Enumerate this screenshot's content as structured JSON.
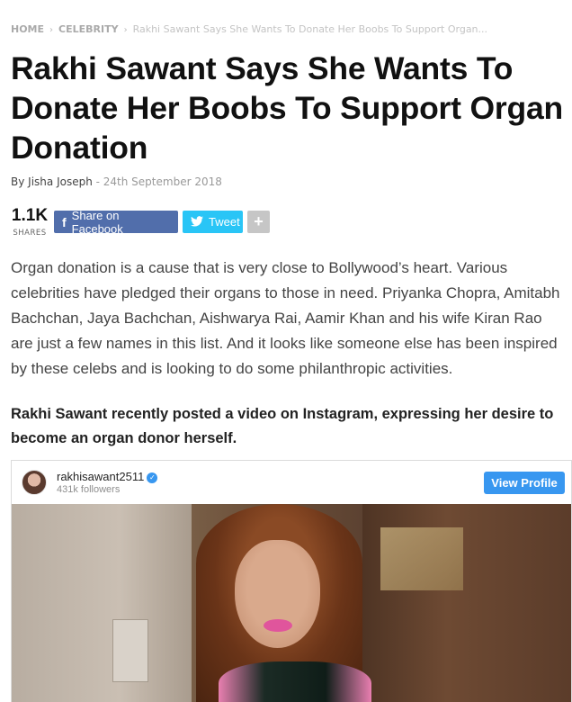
{
  "breadcrumb": {
    "home": "HOME",
    "category": "CELEBRITY",
    "current": "Rakhi Sawant Says She Wants To Donate Her Boobs To Support Organ...",
    "separator": "›"
  },
  "article": {
    "title": "Rakhi Sawant Says She Wants To Donate Her Boobs To Support Organ Donation",
    "by_prefix": "By",
    "author": "Jisha Joseph",
    "date": "- 24th September 2018",
    "body": "Organ donation is a cause that is very close to Bollywood’s heart. Various celebrities have pledged their organs to those in need. Priyanka Chopra, Amitabh Bachchan, Jaya Bachchan, Aishwarya Rai, Aamir Khan and his wife Kiran Rao are just a few names in this list. And it looks like someone else has been inspired by these celebs and is looking to do some philanthropic activities.",
    "lead": "Rakhi Sawant recently posted a video on Instagram, expressing her desire to become an organ donor herself."
  },
  "share": {
    "count": "1.1K",
    "count_label": "SHARES",
    "facebook_label": "Share on Facebook",
    "twitter_label": "Tweet",
    "more_label": "+",
    "facebook_color": "#516eab",
    "twitter_color": "#29c5f6",
    "icons": {
      "facebook": "facebook-icon",
      "twitter": "twitter-icon",
      "more": "plus-icon"
    }
  },
  "instagram": {
    "username": "rakhisawant2511",
    "followers": "431k followers",
    "view_profile": "View Profile",
    "verified_icon": "verified-badge-icon"
  }
}
